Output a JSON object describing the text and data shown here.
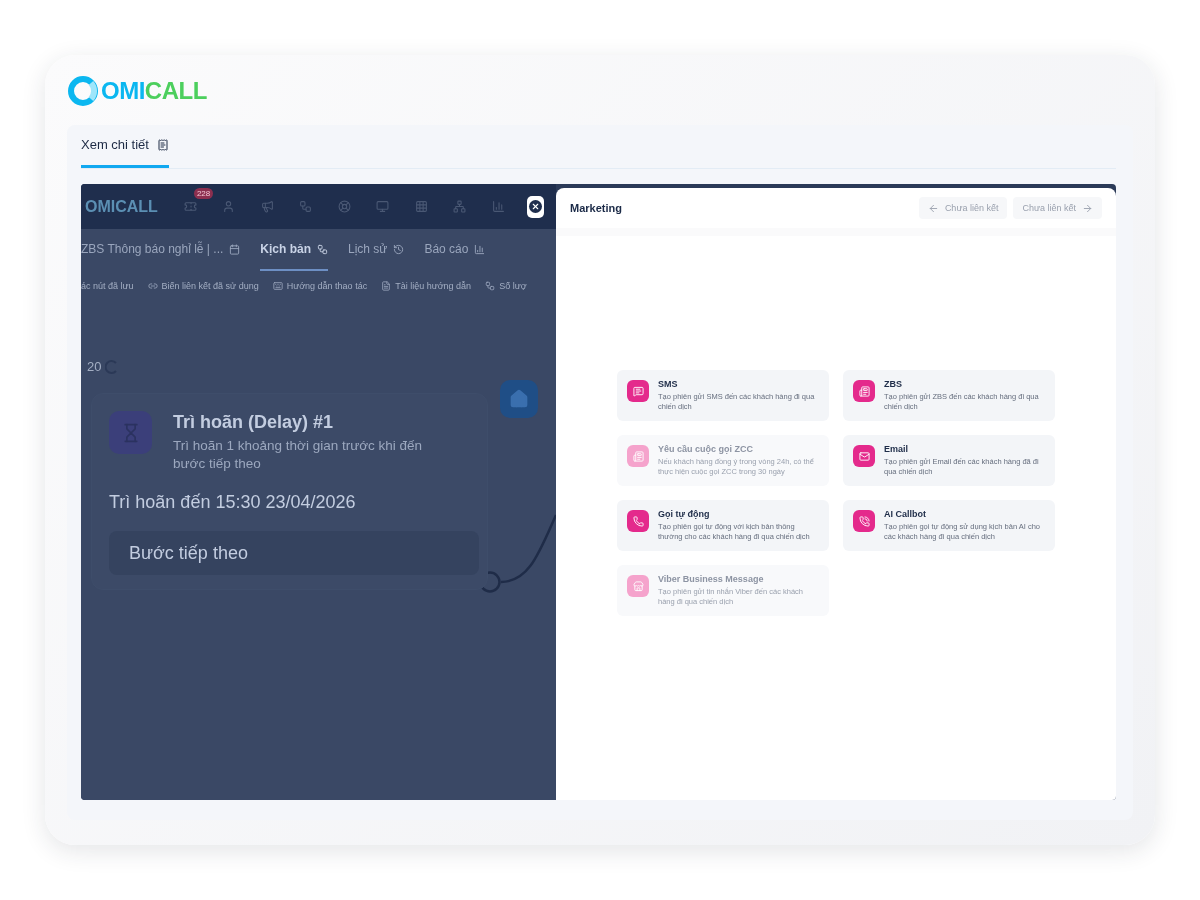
{
  "logo": {
    "part_1": "OMI",
    "part_2": "CALL"
  },
  "panel": {
    "tabs": [
      {
        "label": "Xem chi tiết",
        "selected": true
      }
    ]
  },
  "app": {
    "header": {
      "logo": "OMICALL",
      "badge": "228"
    },
    "tabs": [
      {
        "label": "ZBS Thông báo nghỉ lễ | ...",
        "selected": false,
        "kind": "calendar"
      },
      {
        "label": "Kịch bản",
        "selected": true,
        "kind": "flow"
      },
      {
        "label": "Lịch sử",
        "selected": false,
        "kind": "history"
      },
      {
        "label": "Báo cáo",
        "selected": false,
        "kind": "chart"
      }
    ],
    "toolbar": [
      {
        "label": "ác nút đã lưu",
        "kind": "none"
      },
      {
        "label": "Biến liên kết đã sử dụng",
        "kind": "link"
      },
      {
        "label": "Hướng dẫn thao tác",
        "kind": "keyboard"
      },
      {
        "label": "Tài liệu hướng dẫn",
        "kind": "doc"
      },
      {
        "label": "Số lượ",
        "kind": "flow"
      }
    ],
    "canvas": {
      "zoom": "20",
      "node": {
        "title": "Trì hoãn (Delay) #1",
        "description": "Trì hoãn 1 khoảng thời gian trước khi đến bước tiếp theo",
        "delay_text": "Trì hoãn đến **15:30 23/04/2026**",
        "next_step": "Bước tiếp theo"
      }
    }
  },
  "drawer": {
    "title": "Marketing",
    "nav_buttons": [
      {
        "label": "Chưa liên kết",
        "kind": "prev",
        "disabled": true
      },
      {
        "label": "Chưa liên kết",
        "kind": "next",
        "disabled": true
      }
    ],
    "actions": [
      {
        "title": "SMS",
        "description": "Tạo phiên gửi SMS đến các khách hàng đi qua chiến dịch",
        "kind": "sms",
        "disabled": false
      },
      {
        "title": "ZBS",
        "description": "Tạo phiên gửi ZBS đến các khách hàng đi qua chiến dịch",
        "kind": "zbs",
        "disabled": false
      },
      {
        "title": "Yêu cầu cuộc gọi ZCC",
        "description": "Nếu khách hàng đồng ý trong vòng 24h, có thể thực hiện cuộc gọi ZCC trong 30 ngày",
        "kind": "zbs",
        "disabled": true
      },
      {
        "title": "Email",
        "description": "Tạo phiên gửi Email đến các khách hàng đã đi qua chiến dịch",
        "kind": "email",
        "disabled": false
      },
      {
        "title": "Gọi tự động",
        "description": "Tạo phiên gọi tự động với kịch bản thông thường cho các khách hàng đi qua chiến dịch",
        "kind": "phone",
        "disabled": false
      },
      {
        "title": "AI Callbot",
        "description": "Tạo phiên gọi tự động sử dụng kịch bản AI cho các khách hàng đi qua chiến dịch",
        "kind": "ai_phone",
        "disabled": false
      },
      {
        "title": "Viber Business Message",
        "description": "Tạo phiên gửi tin nhắn Viber đến các khách hàng đi qua chiến dịch",
        "kind": "store",
        "disabled": true
      }
    ]
  }
}
